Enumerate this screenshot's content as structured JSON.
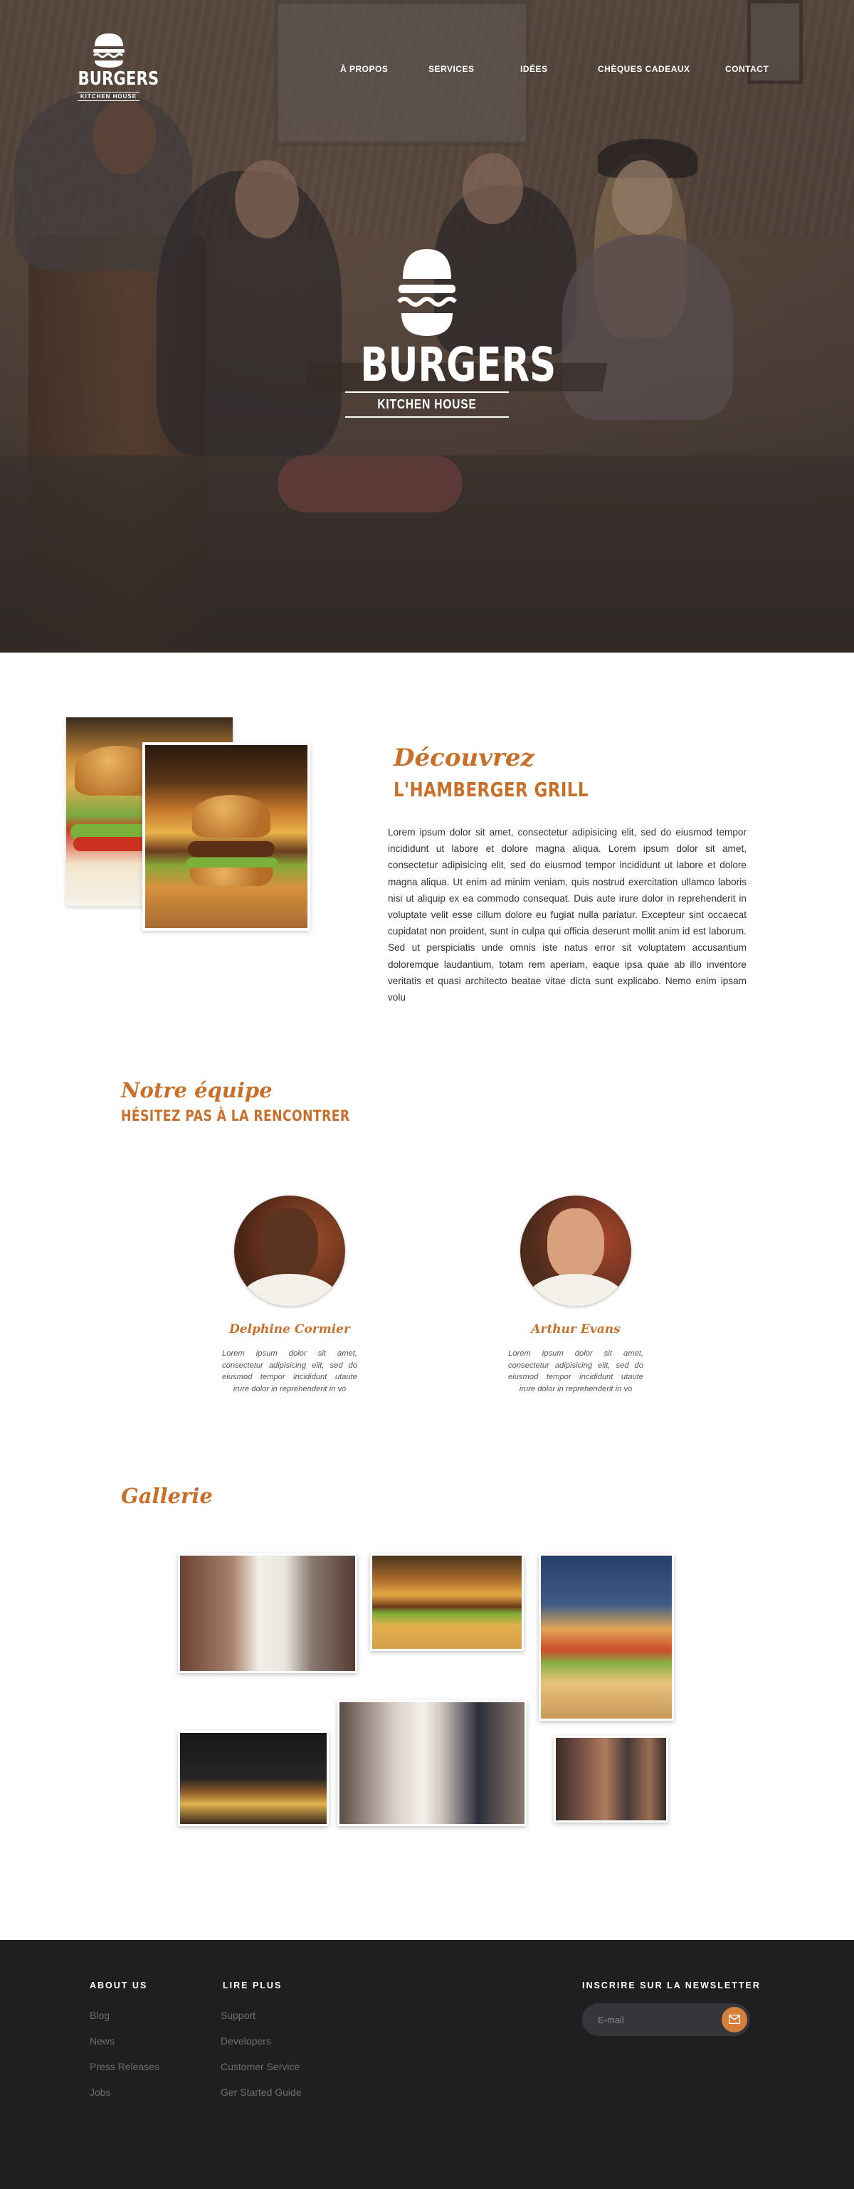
{
  "brand": {
    "name": "BURGERS",
    "tagline": "KITCHEN HOUSE"
  },
  "nav": {
    "items": [
      "À PROPOS",
      "SERVICES",
      "IDÉES",
      "CHÈQUES CADEAUX",
      "CONTACT"
    ]
  },
  "about": {
    "script": "Découvrez",
    "title": "L'HAMBERGER GRILL",
    "body": "Lorem ipsum dolor sit amet, consectetur adipisicing elit, sed do eiusmod tempor incididunt ut labore et dolore magna aliqua. Lorem ipsum dolor sit amet, consectetur adipisicing elit, sed do eiusmod tempor incididunt ut labore et dolore magna aliqua. Ut enim ad minim veniam, quis nostrud exercitation ullamco laboris nisi ut aliquip ex ea commodo consequat. Duis aute irure dolor in reprehenderit in voluptate velit esse cillum dolore eu fugiat nulla pariatur. Excepteur sint occaecat cupidatat non proident, sunt in culpa qui officia deserunt mollit anim id est laborum. Sed ut perspiciatis unde omnis iste natus error sit voluptatem accusantium doloremque laudantium, totam rem aperiam, eaque ipsa quae ab illo inventore veritatis et quasi architecto beatae vitae dicta sunt explicabo. Nemo enim ipsam volu"
  },
  "team": {
    "script": "Notre équipe",
    "title": "HÉSITEZ PAS À LA RENCONTRER",
    "members": [
      {
        "name": "Delphine Cormier",
        "bio": "Lorem ipsum dolor sit amet, consectetur adipisicing elit, sed do eiusmod tempor incididunt utaute irure dolor in reprehenderit in vo"
      },
      {
        "name": "Arthur Evans",
        "bio": "Lorem ipsum dolor sit amet, consectetur adipisicing elit, sed do eiusmod tempor incididunt utaute irure dolor in reprehenderit in vo"
      }
    ]
  },
  "gallery": {
    "title": "Gallerie"
  },
  "footer": {
    "about": {
      "heading": "ABOUT US",
      "links": [
        "Blog",
        "News",
        "Press Releases",
        "Jobs"
      ]
    },
    "read_more": {
      "heading": "LIRE PLUS",
      "links": [
        "Support",
        "Developers",
        "Customer Service",
        "Ger Started Guide"
      ]
    },
    "newsletter": {
      "heading": "INSCRIRE SUR LA NEWSLETTER",
      "placeholder": "E-mail"
    }
  },
  "colors": {
    "accent": "#c8702a",
    "button": "#d5803a",
    "footer_bg": "#1f1f22",
    "footer_link": "#6e6e72"
  }
}
